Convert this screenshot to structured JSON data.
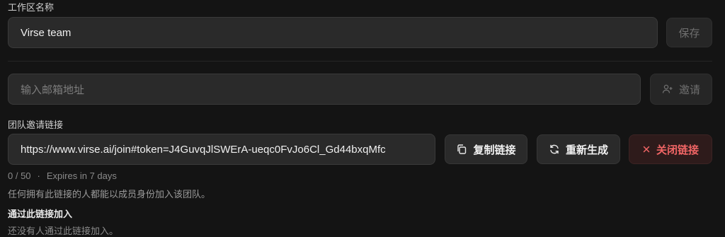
{
  "workspace": {
    "name_label": "工作区名称",
    "name_value": "Virse team",
    "save_label": "保存"
  },
  "invite_email": {
    "placeholder": "输入邮箱地址",
    "invite_label": "邀请"
  },
  "invite_link": {
    "section_label": "团队邀请链接",
    "url": "https://www.virse.ai/join#token=J4GuvqJlSWErA-ueqc0FvJo6Cl_Gd44bxqMfc",
    "copy_label": "复制链接",
    "regenerate_label": "重新生成",
    "close_label": "关闭链接",
    "usage": "0 / 50",
    "separator": "·",
    "expires": "Expires in 7 days",
    "description": "任何拥有此链接的人都能以成员身份加入该团队。"
  },
  "joined_via_link": {
    "heading": "通过此链接加入",
    "empty_text": "还没有人通过此链接加入。"
  },
  "icons": {
    "invite": "user-plus-icon",
    "copy": "copy-icon",
    "regenerate": "refresh-icon",
    "close": "close-icon"
  },
  "colors": {
    "background": "#141414",
    "danger": "#f06565"
  }
}
